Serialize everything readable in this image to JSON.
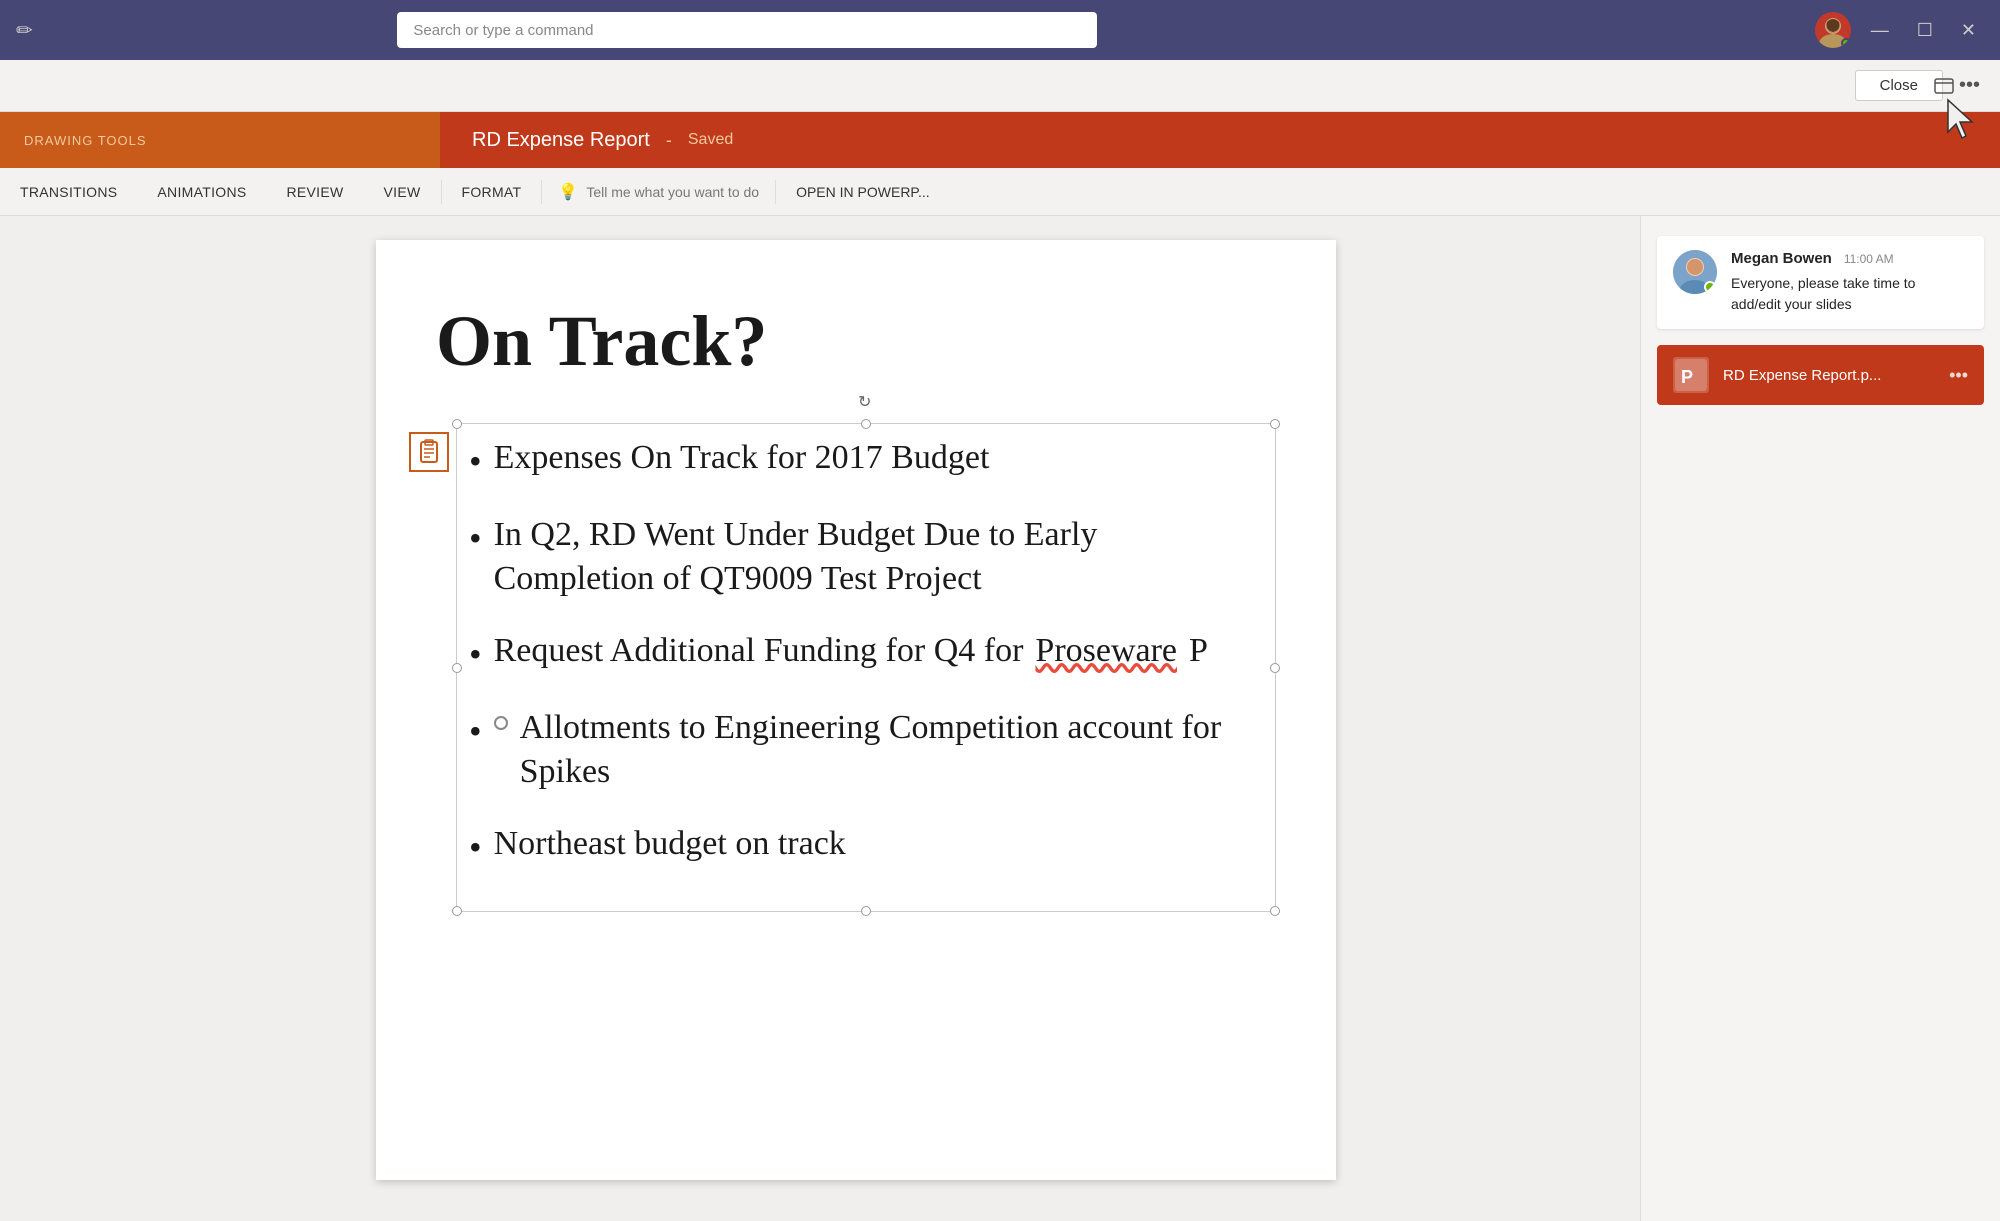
{
  "teams": {
    "titlebar": {
      "search_placeholder": "Search or type a command",
      "edit_icon": "✏",
      "minimize": "—",
      "maximize": "☐",
      "close": "✕"
    }
  },
  "ppt": {
    "actionbar": {
      "close_label": "Close",
      "more_label": "•••"
    },
    "ribbon": {
      "drawing_tools_label": "DRAWING TOOLS",
      "file_name": "RD Expense Report",
      "dash": "-",
      "status": "Saved"
    },
    "tabs": [
      {
        "label": "TRANSITIONS"
      },
      {
        "label": "ANIMATIONS"
      },
      {
        "label": "REVIEW"
      },
      {
        "label": "VIEW"
      },
      {
        "label": "FORMAT"
      },
      {
        "label": "Tell me what you want to do"
      },
      {
        "label": "OPEN IN POWERP..."
      }
    ],
    "slide": {
      "title": "On Track?",
      "bullets": [
        {
          "text": "Expenses On Track for 2017 Budget",
          "type": "filled"
        },
        {
          "text": "In Q2, RD Went Under Budget Due to Early Completion of QT9009 Test Project",
          "type": "filled"
        },
        {
          "text": "Request Additional Funding for Q4 for Proseware P",
          "type": "filled"
        },
        {
          "text": "Allotments to Engineering Competition account for Spikes",
          "type": "circle"
        },
        {
          "text": "Northeast budget on track",
          "type": "filled"
        }
      ]
    }
  },
  "chat": {
    "message": {
      "sender": "Megan Bowen",
      "time": "11:00 AM",
      "text": "Everyone, please take time to add/edit your slides"
    },
    "attachment": {
      "name": "RD Expense Report.p...",
      "icon": "P"
    }
  },
  "icons": {
    "lightbulb": "💡",
    "rotate": "↻",
    "paste": "📋"
  }
}
